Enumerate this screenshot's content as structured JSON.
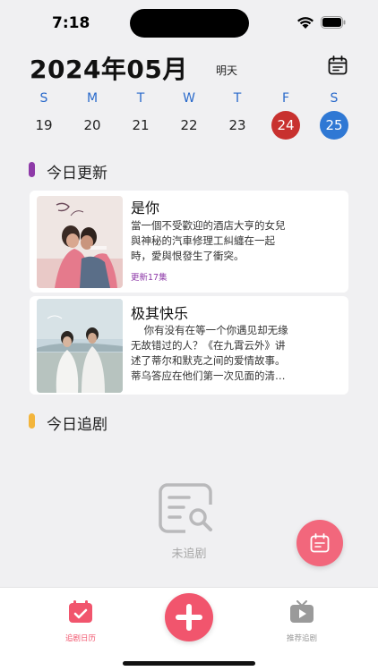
{
  "status": {
    "time": "7:18"
  },
  "header": {
    "month_title": "2024年05月",
    "tomorrow": "明天"
  },
  "week": [
    {
      "letter": "S",
      "date": "19",
      "state": "normal"
    },
    {
      "letter": "M",
      "date": "20",
      "state": "normal"
    },
    {
      "letter": "T",
      "date": "21",
      "state": "normal"
    },
    {
      "letter": "W",
      "date": "22",
      "state": "normal"
    },
    {
      "letter": "T",
      "date": "23",
      "state": "normal"
    },
    {
      "letter": "F",
      "date": "24",
      "state": "highlight-red"
    },
    {
      "letter": "S",
      "date": "25",
      "state": "selected-blue"
    }
  ],
  "today_updates": {
    "title": "今日更新",
    "accent": "#8e3aa8",
    "items": [
      {
        "title": "是你",
        "desc_lines": [
          "當一個不受歡迎的酒店大亨的女兒",
          "與神秘的汽車修理工糾纏在一起",
          "時，愛與恨發生了衝突。"
        ],
        "update": "更新17集"
      },
      {
        "title": "极其快乐",
        "desc_lines": [
          "    你有没有在等一个你遇见却无缘",
          "无故错过的人？《在九霄云外》讲",
          "述了蒂尔和默克之间的爱情故事。",
          "蒂乌答应在他们第一次见面的清…"
        ],
        "update": ""
      }
    ]
  },
  "today_follow": {
    "title": "今日追剧",
    "accent": "#f3b53c",
    "empty_text": "未追剧"
  },
  "tabs": [
    {
      "label": "追剧日历",
      "color": "#f1556d"
    },
    {
      "label": "推荐追剧",
      "color": "#999999"
    }
  ],
  "colors": {
    "blue": "#2f78d4",
    "red": "#c8312f",
    "pink": "#f1556d"
  }
}
